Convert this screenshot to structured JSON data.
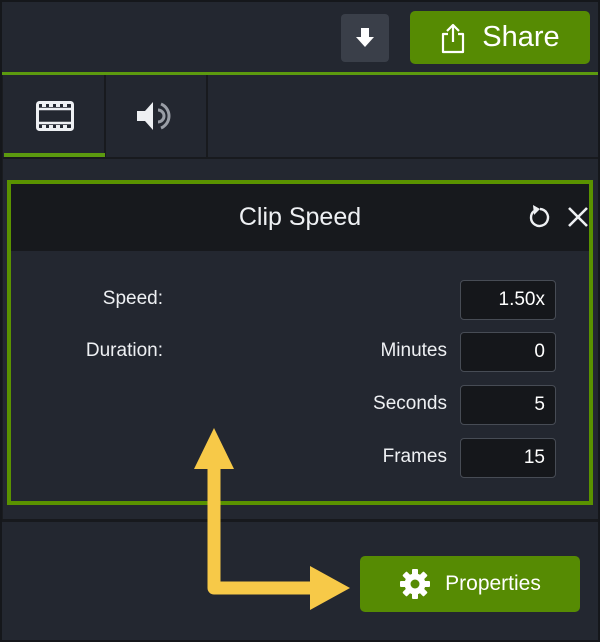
{
  "toolbar": {
    "download_icon": "download-arrow-icon",
    "share_label": "Share",
    "share_icon": "share-upload-icon"
  },
  "tabs": [
    {
      "name": "video",
      "icon": "film-strip-icon",
      "active": true
    },
    {
      "name": "audio",
      "icon": "speaker-icon",
      "active": false
    }
  ],
  "panel": {
    "title": "Clip Speed",
    "reset_icon": "reset-icon",
    "close_icon": "close-icon",
    "speed_label": "Speed:",
    "speed_value": "1.50x",
    "duration_label": "Duration:",
    "minutes_label": "Minutes",
    "minutes_value": "0",
    "seconds_label": "Seconds",
    "seconds_value": "5",
    "frames_label": "Frames",
    "frames_value": "15"
  },
  "properties_button": {
    "label": "Properties",
    "icon": "gear-icon"
  },
  "colors": {
    "accent_green": "#568b03",
    "highlight_border": "#5a9200",
    "annotation_arrow": "#f7c948",
    "background": "#232730"
  }
}
